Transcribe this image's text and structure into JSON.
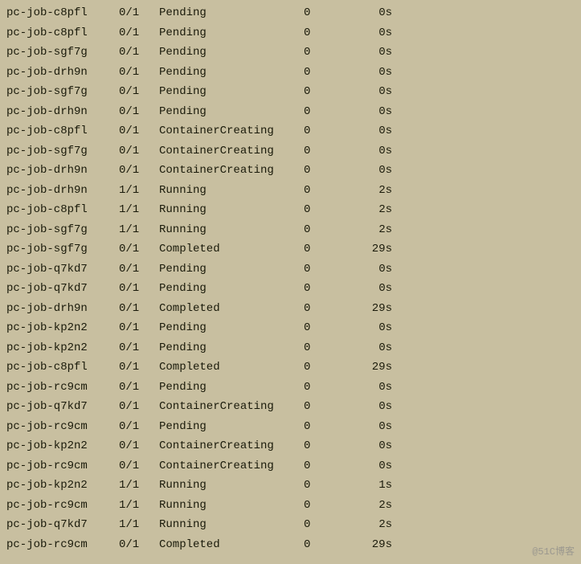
{
  "rows": [
    {
      "name": "pc-job-c8pfl",
      "ready": "0/1",
      "status": "Pending",
      "restarts": "0",
      "age": "0s"
    },
    {
      "name": "pc-job-c8pfl",
      "ready": "0/1",
      "status": "Pending",
      "restarts": "0",
      "age": "0s"
    },
    {
      "name": "pc-job-sgf7g",
      "ready": "0/1",
      "status": "Pending",
      "restarts": "0",
      "age": "0s"
    },
    {
      "name": "pc-job-drh9n",
      "ready": "0/1",
      "status": "Pending",
      "restarts": "0",
      "age": "0s"
    },
    {
      "name": "pc-job-sgf7g",
      "ready": "0/1",
      "status": "Pending",
      "restarts": "0",
      "age": "0s"
    },
    {
      "name": "pc-job-drh9n",
      "ready": "0/1",
      "status": "Pending",
      "restarts": "0",
      "age": "0s"
    },
    {
      "name": "pc-job-c8pfl",
      "ready": "0/1",
      "status": "ContainerCreating",
      "restarts": "0",
      "age": "0s"
    },
    {
      "name": "pc-job-sgf7g",
      "ready": "0/1",
      "status": "ContainerCreating",
      "restarts": "0",
      "age": "0s"
    },
    {
      "name": "pc-job-drh9n",
      "ready": "0/1",
      "status": "ContainerCreating",
      "restarts": "0",
      "age": "0s"
    },
    {
      "name": "pc-job-drh9n",
      "ready": "1/1",
      "status": "Running",
      "restarts": "0",
      "age": "2s"
    },
    {
      "name": "pc-job-c8pfl",
      "ready": "1/1",
      "status": "Running",
      "restarts": "0",
      "age": "2s"
    },
    {
      "name": "pc-job-sgf7g",
      "ready": "1/1",
      "status": "Running",
      "restarts": "0",
      "age": "2s"
    },
    {
      "name": "pc-job-sgf7g",
      "ready": "0/1",
      "status": "Completed",
      "restarts": "0",
      "age": "29s"
    },
    {
      "name": "pc-job-q7kd7",
      "ready": "0/1",
      "status": "Pending",
      "restarts": "0",
      "age": "0s"
    },
    {
      "name": "pc-job-q7kd7",
      "ready": "0/1",
      "status": "Pending",
      "restarts": "0",
      "age": "0s"
    },
    {
      "name": "pc-job-drh9n",
      "ready": "0/1",
      "status": "Completed",
      "restarts": "0",
      "age": "29s"
    },
    {
      "name": "pc-job-kp2n2",
      "ready": "0/1",
      "status": "Pending",
      "restarts": "0",
      "age": "0s"
    },
    {
      "name": "pc-job-kp2n2",
      "ready": "0/1",
      "status": "Pending",
      "restarts": "0",
      "age": "0s"
    },
    {
      "name": "pc-job-c8pfl",
      "ready": "0/1",
      "status": "Completed",
      "restarts": "0",
      "age": "29s"
    },
    {
      "name": "pc-job-rc9cm",
      "ready": "0/1",
      "status": "Pending",
      "restarts": "0",
      "age": "0s"
    },
    {
      "name": "pc-job-q7kd7",
      "ready": "0/1",
      "status": "ContainerCreating",
      "restarts": "0",
      "age": "0s"
    },
    {
      "name": "pc-job-rc9cm",
      "ready": "0/1",
      "status": "Pending",
      "restarts": "0",
      "age": "0s"
    },
    {
      "name": "pc-job-kp2n2",
      "ready": "0/1",
      "status": "ContainerCreating",
      "restarts": "0",
      "age": "0s"
    },
    {
      "name": "pc-job-rc9cm",
      "ready": "0/1",
      "status": "ContainerCreating",
      "restarts": "0",
      "age": "0s"
    },
    {
      "name": "pc-job-kp2n2",
      "ready": "1/1",
      "status": "Running",
      "restarts": "0",
      "age": "1s"
    },
    {
      "name": "pc-job-rc9cm",
      "ready": "1/1",
      "status": "Running",
      "restarts": "0",
      "age": "2s"
    },
    {
      "name": "pc-job-q7kd7",
      "ready": "1/1",
      "status": "Running",
      "restarts": "0",
      "age": "2s"
    },
    {
      "name": "pc-job-rc9cm",
      "ready": "0/1",
      "status": "Completed",
      "restarts": "0",
      "age": "29s"
    }
  ],
  "watermark": "@51C博客"
}
